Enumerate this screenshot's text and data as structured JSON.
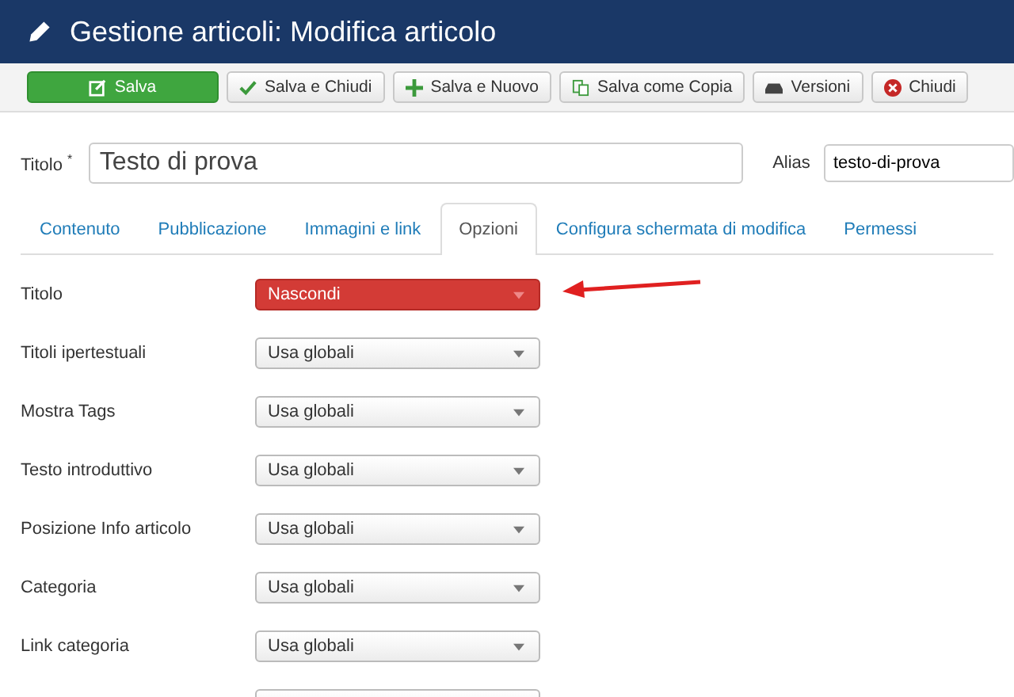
{
  "header": {
    "title": "Gestione articoli: Modifica articolo"
  },
  "toolbar": [
    {
      "label": "Salva",
      "kind": "save"
    },
    {
      "label": "Salva e Chiudi",
      "kind": "check"
    },
    {
      "label": "Salva e Nuovo",
      "kind": "new"
    },
    {
      "label": "Salva come Copia",
      "kind": "copy"
    },
    {
      "label": "Versioni",
      "kind": "versions"
    },
    {
      "label": "Chiudi",
      "kind": "close"
    }
  ],
  "title_field": {
    "label": "Titolo",
    "required_mark": "*",
    "value": "Testo di prova"
  },
  "alias_field": {
    "label": "Alias",
    "value": "testo-di-prova"
  },
  "tabs": [
    {
      "label": "Contenuto",
      "selected": false
    },
    {
      "label": "Pubblicazione",
      "selected": false
    },
    {
      "label": "Immagini e link",
      "selected": false
    },
    {
      "label": "Opzioni",
      "selected": true
    },
    {
      "label": "Configura schermata di modifica",
      "selected": false
    },
    {
      "label": "Permessi",
      "selected": false
    }
  ],
  "options": [
    {
      "kind": "select",
      "label": "Titolo",
      "value": "Nascondi",
      "highlighted": true
    },
    {
      "kind": "select",
      "label": "Titoli ipertestuali",
      "value": "Usa globali",
      "highlighted": false
    },
    {
      "kind": "select",
      "label": "Mostra Tags",
      "value": "Usa globali",
      "highlighted": false
    },
    {
      "kind": "select",
      "label": "Testo introduttivo",
      "value": "Usa globali",
      "highlighted": false
    },
    {
      "kind": "select",
      "label": "Posizione Info articolo",
      "value": "Usa globali",
      "highlighted": false
    },
    {
      "kind": "select",
      "label": "Categoria",
      "value": "Usa globali",
      "highlighted": false
    },
    {
      "kind": "select",
      "label": "Link categoria",
      "value": "Usa globali",
      "highlighted": false
    },
    {
      "kind": "cut"
    }
  ]
}
